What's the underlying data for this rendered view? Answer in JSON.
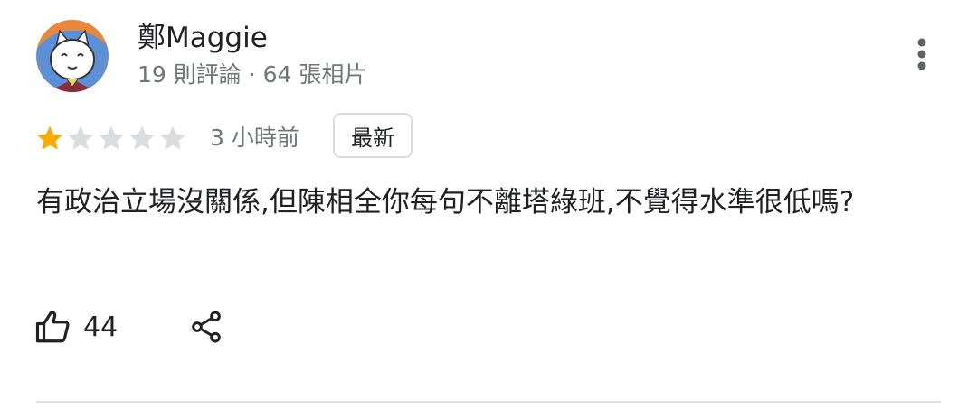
{
  "author": {
    "name": "鄭Maggie",
    "meta": "19 則評論 · 64 張相片",
    "avatar_icon": "cat-mascot-avatar"
  },
  "review": {
    "rating": 1,
    "max_rating": 5,
    "time": "3 小時前",
    "badge": "最新",
    "text": "有政治立場沒關係,但陳相全你每句不離塔綠班,不覺得水準很低嗎?"
  },
  "actions": {
    "like_count": "44",
    "like_icon": "thumbs-up-icon",
    "share_icon": "share-icon",
    "more_icon": "more-vert-icon"
  },
  "colors": {
    "star_filled": "#f9ab00",
    "star_empty": "#dadce0",
    "secondary_text": "#70757a",
    "primary_text": "#202124"
  }
}
